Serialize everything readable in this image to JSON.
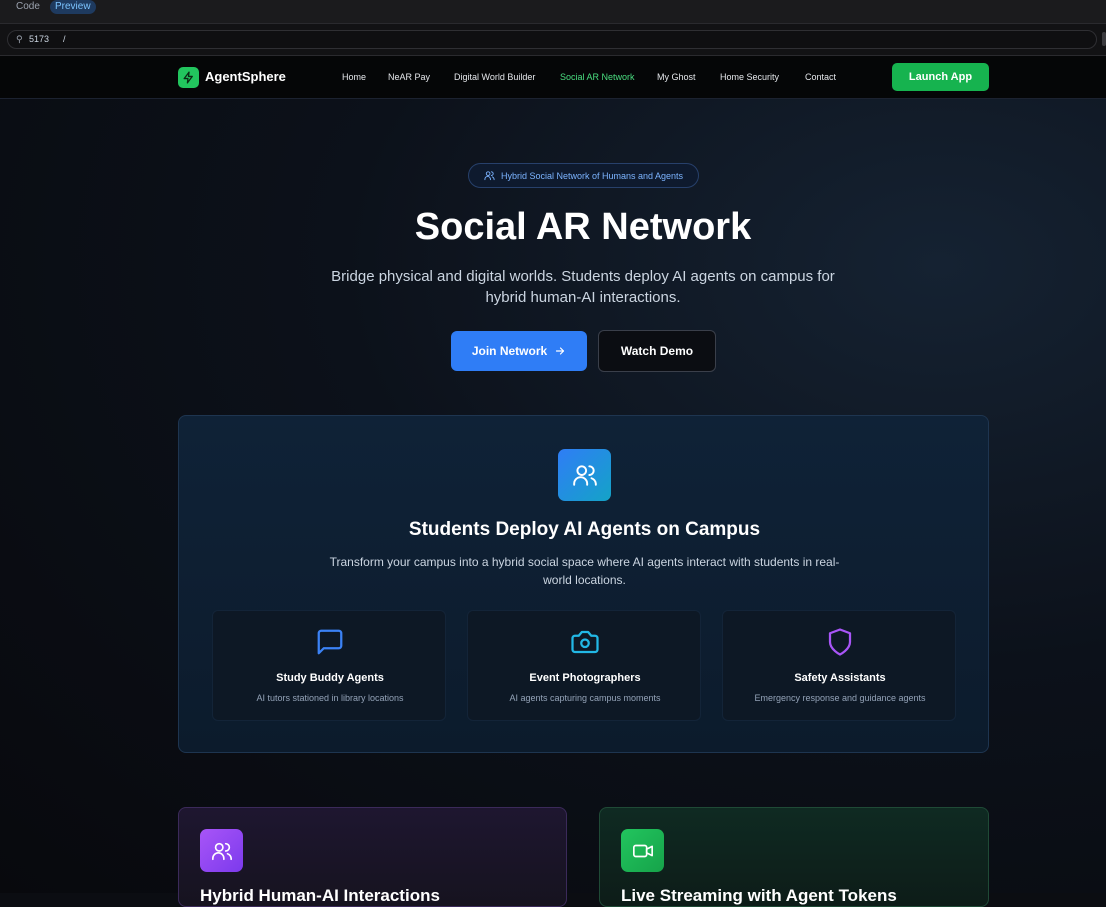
{
  "editor": {
    "tabs": [
      {
        "label": "Code"
      },
      {
        "label": "Preview"
      }
    ],
    "url": {
      "port": "5173",
      "path": "/"
    }
  },
  "nav": {
    "brand": "AgentSphere",
    "links": [
      {
        "label": "Home"
      },
      {
        "label": "NeAR Pay"
      },
      {
        "label": "Digital World Builder"
      },
      {
        "label": "Social AR Network"
      },
      {
        "label": "My Ghost"
      },
      {
        "label": "Home Security"
      },
      {
        "label": "Contact"
      }
    ],
    "active": "Social AR Network",
    "launch_label": "Launch App"
  },
  "hero": {
    "badge": "Hybrid Social Network of Humans and Agents",
    "title": "Social AR Network",
    "subtitle": "Bridge physical and digital worlds. Students deploy AI agents on campus for hybrid human-AI interactions.",
    "join_label": "Join Network",
    "demo_label": "Watch Demo"
  },
  "campus": {
    "title": "Students Deploy AI Agents on Campus",
    "description": "Transform your campus into a hybrid social space where AI agents interact with students in real-world locations.",
    "features": [
      {
        "icon": "message-square-icon",
        "title": "Study Buddy Agents",
        "desc": "AI tutors stationed in library locations"
      },
      {
        "icon": "camera-icon",
        "title": "Event Photographers",
        "desc": "AI agents capturing campus moments"
      },
      {
        "icon": "shield-icon",
        "title": "Safety Assistants",
        "desc": "Emergency response and guidance agents"
      }
    ]
  },
  "cards": [
    {
      "icon": "users-icon",
      "title": "Hybrid Human-AI Interactions"
    },
    {
      "icon": "video-icon",
      "title": "Live Streaming with Agent Tokens"
    }
  ],
  "colors": {
    "accent_green": "#22c55e",
    "accent_blue": "#2f7df6",
    "active_link": "#4ade80"
  }
}
